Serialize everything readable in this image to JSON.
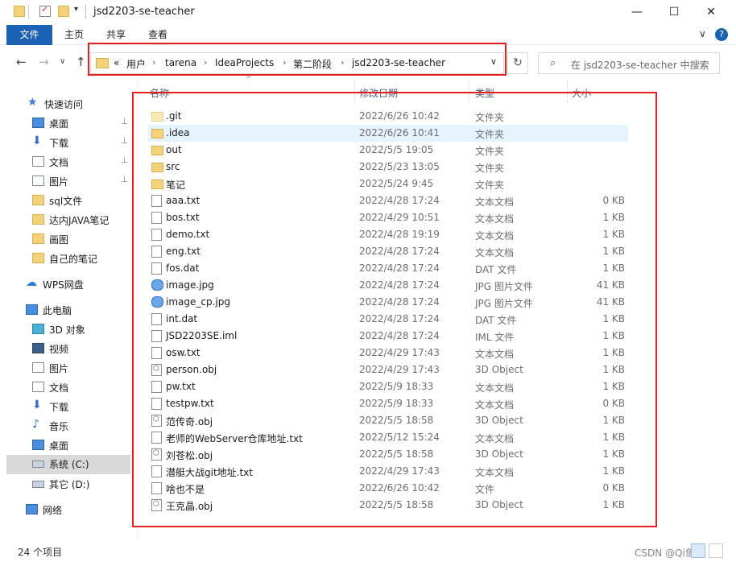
{
  "window": {
    "title": "jsd2203-se-teacher",
    "minimize": "—",
    "maximize": "☐",
    "close": "✕"
  },
  "ribbon": {
    "tabs": [
      "文件",
      "主页",
      "共享",
      "查看"
    ],
    "expand": "∨"
  },
  "nav": {
    "back": "←",
    "forward": "→",
    "recent": "∨",
    "up": "↑",
    "breadcrumb_prefix": "«",
    "breadcrumb": [
      "用户",
      "tarena",
      "IdeaProjects",
      "第二阶段",
      "jsd2203-se-teacher"
    ],
    "crumb_sep": "›",
    "dropdown": "∨",
    "refresh": "↻",
    "search_placeholder": "在 jsd2203-se-teacher 中搜索"
  },
  "sidebar": {
    "items": [
      {
        "label": "快速访问",
        "icon": "star-icon"
      },
      {
        "label": "桌面",
        "icon": "desktop-icon",
        "pinned": true
      },
      {
        "label": "下载",
        "icon": "download-icon",
        "pinned": true
      },
      {
        "label": "文档",
        "icon": "document-icon",
        "pinned": true
      },
      {
        "label": "图片",
        "icon": "picture-icon",
        "pinned": true
      },
      {
        "label": "sql文件",
        "icon": "folder-icon"
      },
      {
        "label": "达内JAVA笔记",
        "icon": "folder-icon"
      },
      {
        "label": "画图",
        "icon": "folder-icon"
      },
      {
        "label": "自己的笔记",
        "icon": "folder-icon"
      },
      {
        "label": "WPS网盘",
        "icon": "cloud-icon"
      },
      {
        "label": "此电脑",
        "icon": "computer-icon"
      },
      {
        "label": "3D 对象",
        "icon": "cube-icon"
      },
      {
        "label": "视频",
        "icon": "video-icon"
      },
      {
        "label": "图片",
        "icon": "picture-icon"
      },
      {
        "label": "文档",
        "icon": "document-icon"
      },
      {
        "label": "下载",
        "icon": "download-icon"
      },
      {
        "label": "音乐",
        "icon": "music-icon"
      },
      {
        "label": "桌面",
        "icon": "desktop-icon"
      },
      {
        "label": "系统 (C:)",
        "icon": "drive-icon",
        "selected": true
      },
      {
        "label": "其它 (D:)",
        "icon": "drive-icon"
      },
      {
        "label": "网络",
        "icon": "network-icon"
      }
    ],
    "pin_glyph": "📌"
  },
  "list": {
    "columns": [
      "名称",
      "修改日期",
      "类型",
      "大小"
    ],
    "sort_indicator": "^",
    "rows": [
      {
        "name": ".git",
        "date": "2022/6/26 10:42",
        "type": "文件夹",
        "size": "",
        "icon": "folder-light"
      },
      {
        "name": ".idea",
        "date": "2022/6/26 10:41",
        "type": "文件夹",
        "size": "",
        "icon": "folder",
        "highlighted": true
      },
      {
        "name": "out",
        "date": "2022/5/5 19:05",
        "type": "文件夹",
        "size": "",
        "icon": "folder"
      },
      {
        "name": "src",
        "date": "2022/5/23 13:05",
        "type": "文件夹",
        "size": "",
        "icon": "folder"
      },
      {
        "name": "笔记",
        "date": "2022/5/24 9:45",
        "type": "文件夹",
        "size": "",
        "icon": "folder"
      },
      {
        "name": "aaa.txt",
        "date": "2022/4/28 17:24",
        "type": "文本文档",
        "size": "0 KB",
        "icon": "file"
      },
      {
        "name": "bos.txt",
        "date": "2022/4/29 10:51",
        "type": "文本文档",
        "size": "1 KB",
        "icon": "file"
      },
      {
        "name": "demo.txt",
        "date": "2022/4/28 19:19",
        "type": "文本文档",
        "size": "1 KB",
        "icon": "file"
      },
      {
        "name": "eng.txt",
        "date": "2022/4/28 17:24",
        "type": "文本文档",
        "size": "1 KB",
        "icon": "file"
      },
      {
        "name": "fos.dat",
        "date": "2022/4/28 17:24",
        "type": "DAT 文件",
        "size": "1 KB",
        "icon": "file"
      },
      {
        "name": "image.jpg",
        "date": "2022/4/28 17:24",
        "type": "JPG 图片文件",
        "size": "41 KB",
        "icon": "img"
      },
      {
        "name": "image_cp.jpg",
        "date": "2022/4/28 17:24",
        "type": "JPG 图片文件",
        "size": "41 KB",
        "icon": "img"
      },
      {
        "name": "int.dat",
        "date": "2022/4/28 17:24",
        "type": "DAT 文件",
        "size": "1 KB",
        "icon": "file"
      },
      {
        "name": "JSD2203SE.iml",
        "date": "2022/4/28 17:24",
        "type": "IML 文件",
        "size": "1 KB",
        "icon": "file"
      },
      {
        "name": "osw.txt",
        "date": "2022/4/29 17:43",
        "type": "文本文档",
        "size": "1 KB",
        "icon": "file"
      },
      {
        "name": "person.obj",
        "date": "2022/4/29 17:43",
        "type": "3D Object",
        "size": "1 KB",
        "icon": "obj"
      },
      {
        "name": "pw.txt",
        "date": "2022/5/9 18:33",
        "type": "文本文档",
        "size": "1 KB",
        "icon": "file"
      },
      {
        "name": "testpw.txt",
        "date": "2022/5/9 18:33",
        "type": "文本文档",
        "size": "0 KB",
        "icon": "file"
      },
      {
        "name": "范传奇.obj",
        "date": "2022/5/5 18:58",
        "type": "3D Object",
        "size": "1 KB",
        "icon": "obj"
      },
      {
        "name": "老师的WebServer仓库地址.txt",
        "date": "2022/5/12 15:24",
        "type": "文本文档",
        "size": "1 KB",
        "icon": "file"
      },
      {
        "name": "刘苍松.obj",
        "date": "2022/5/5 18:58",
        "type": "3D Object",
        "size": "1 KB",
        "icon": "obj"
      },
      {
        "name": "潜艇大战git地址.txt",
        "date": "2022/4/29 17:43",
        "type": "文本文档",
        "size": "1 KB",
        "icon": "file"
      },
      {
        "name": "啥也不是",
        "date": "2022/6/26 10:42",
        "type": "文件",
        "size": "0 KB",
        "icon": "file"
      },
      {
        "name": "王克晶.obj",
        "date": "2022/5/5 18:58",
        "type": "3D Object",
        "size": "1 KB",
        "icon": "obj"
      }
    ]
  },
  "status": {
    "count": "24 个项目",
    "watermark": "CSDN @Qi鱼丸"
  },
  "colors": {
    "accent": "#1c62b4",
    "annotation_red": "#e61e1e",
    "selection": "#e5f3ff"
  }
}
